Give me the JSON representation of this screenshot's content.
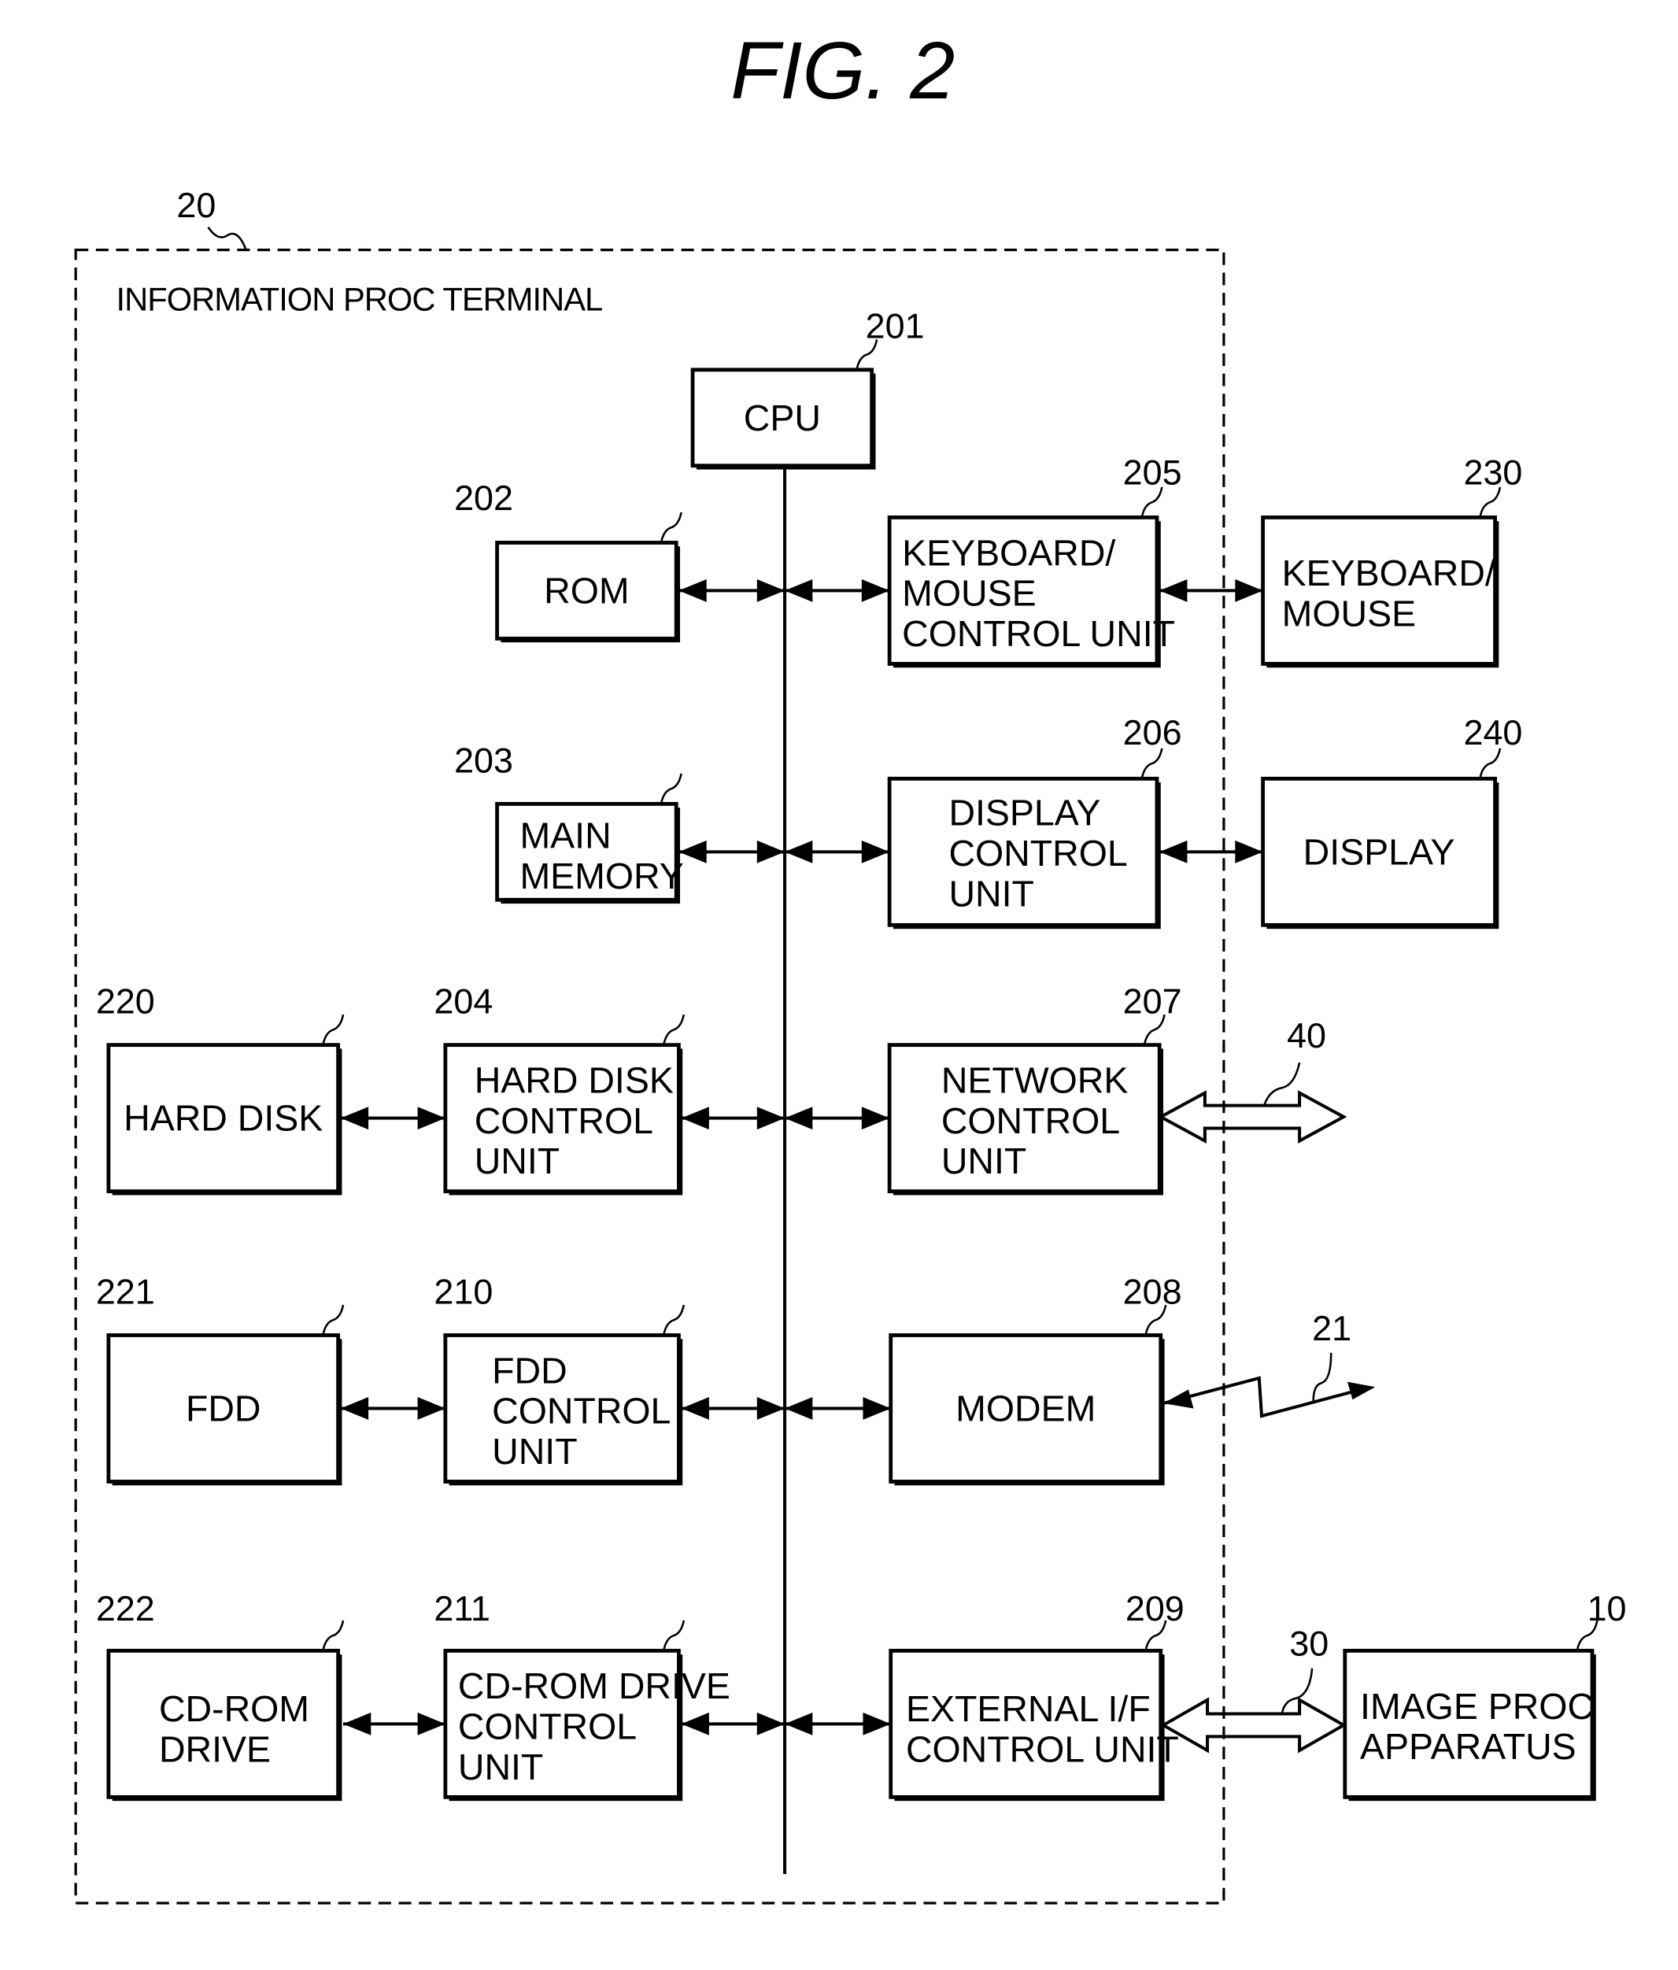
{
  "figure": {
    "title": "FIG.  2",
    "terminal": {
      "ref": "20",
      "label": "INFORMATION PROC TERMINAL"
    }
  },
  "blocks": [
    {
      "id": "cpu",
      "ref": "201",
      "lines": [
        "CPU"
      ]
    },
    {
      "id": "rom",
      "ref": "202",
      "lines": [
        "ROM"
      ]
    },
    {
      "id": "main-memory",
      "ref": "203",
      "lines": [
        "MAIN",
        "MEMORY"
      ]
    },
    {
      "id": "hdd-control",
      "ref": "204",
      "lines": [
        "HARD DISK",
        "CONTROL",
        "UNIT"
      ]
    },
    {
      "id": "kbd-control",
      "ref": "205",
      "lines": [
        "KEYBOARD/",
        "MOUSE",
        "CONTROL UNIT"
      ]
    },
    {
      "id": "display-control",
      "ref": "206",
      "lines": [
        "DISPLAY",
        "CONTROL",
        "UNIT"
      ]
    },
    {
      "id": "network-control",
      "ref": "207",
      "lines": [
        "NETWORK",
        "CONTROL",
        "UNIT"
      ]
    },
    {
      "id": "modem",
      "ref": "208",
      "lines": [
        "MODEM"
      ]
    },
    {
      "id": "ext-if-control",
      "ref": "209",
      "lines": [
        "EXTERNAL I/F",
        "CONTROL UNIT"
      ]
    },
    {
      "id": "fdd-control",
      "ref": "210",
      "lines": [
        "FDD",
        "CONTROL",
        "UNIT"
      ]
    },
    {
      "id": "cdrom-control",
      "ref": "211",
      "lines": [
        "CD-ROM DRIVE",
        "CONTROL",
        "UNIT"
      ]
    },
    {
      "id": "hard-disk",
      "ref": "220",
      "lines": [
        "HARD DISK"
      ]
    },
    {
      "id": "fdd",
      "ref": "221",
      "lines": [
        "FDD"
      ]
    },
    {
      "id": "cdrom-drive",
      "ref": "222",
      "lines": [
        "CD-ROM",
        "DRIVE"
      ]
    },
    {
      "id": "keyboard-mouse",
      "ref": "230",
      "lines": [
        "KEYBOARD/",
        "MOUSE"
      ]
    },
    {
      "id": "display",
      "ref": "240",
      "lines": [
        "DISPLAY"
      ]
    },
    {
      "id": "image-proc",
      "ref": "10",
      "lines": [
        "IMAGE PROC",
        "APPARATUS"
      ]
    }
  ],
  "connections": {
    "network_ref": "40",
    "wireless_ref": "21",
    "external_link_ref": "30"
  }
}
